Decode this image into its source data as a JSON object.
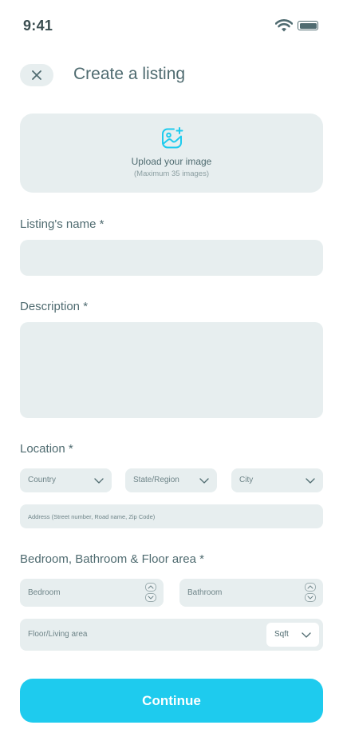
{
  "status_bar": {
    "time": "9:41"
  },
  "header": {
    "title": "Create a listing",
    "close_icon": "close-icon"
  },
  "upload": {
    "title": "Upload your image",
    "subtitle": "(Maximum 35 images)",
    "icon": "image-add-icon"
  },
  "form": {
    "name_label": "Listing's name *",
    "name_value": "",
    "description_label": "Description *",
    "description_value": "",
    "location_label": "Location *",
    "country_placeholder": "Country",
    "state_placeholder": "State/Region",
    "city_placeholder": "City",
    "address_placeholder": "Address (Street number, Road name, Zip Code)",
    "rooms_label": "Bedroom, Bathroom & Floor area *",
    "bedroom_placeholder": "Bedroom",
    "bathroom_placeholder": "Bathroom",
    "floor_placeholder": "Floor/Living area",
    "unit_value": "Sqft"
  },
  "actions": {
    "continue_label": "Continue"
  },
  "colors": {
    "accent": "#1ecbee",
    "field_bg": "#e7eeef",
    "text": "#4f6b70"
  }
}
